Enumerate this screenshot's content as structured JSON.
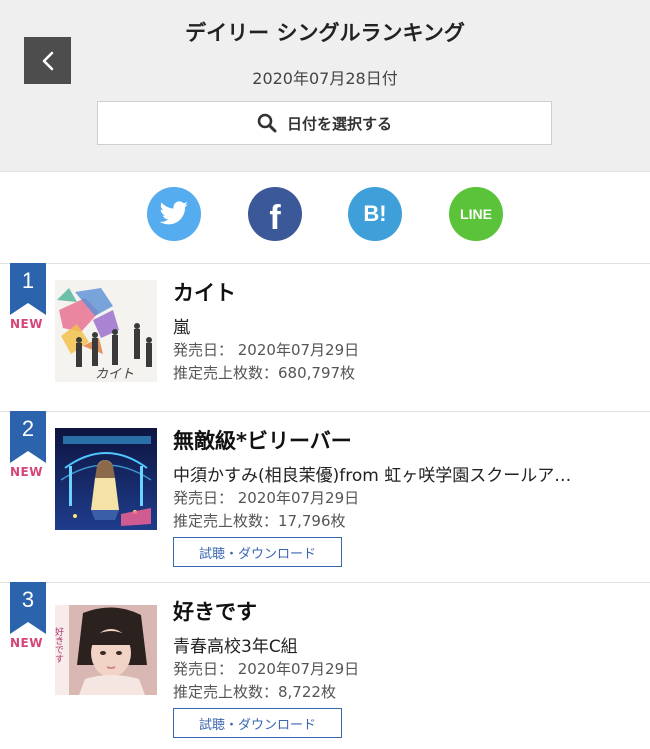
{
  "header": {
    "title": "デイリー シングルランキング",
    "date": "2020年07月28日付",
    "date_picker_label": "日付を選択する"
  },
  "share": {
    "facebook_glyph": "f",
    "hatena_glyph": "B!",
    "line_glyph": "LINE",
    "colors": {
      "twitter": "#55acee",
      "facebook": "#3b5998",
      "hatena": "#3e9fd9",
      "line": "#5ac339"
    }
  },
  "accent": {
    "rank_badge": "#2b63ad",
    "new_label": "#d6457a",
    "button": "#3b67b1"
  },
  "ranking": [
    {
      "rank": "1",
      "new": "NEW",
      "title": "カイト",
      "artist": "嵐",
      "release": "発売日： 2020年07月29日",
      "sales": "推定売上枚数：680,797枚",
      "art_text": "カイト"
    },
    {
      "rank": "2",
      "new": "NEW",
      "title": "無敵級*ビリーバー",
      "artist": "中須かすみ(相良茉優)from 虹ヶ咲学園スクールア…",
      "release": "発売日： 2020年07月29日",
      "sales": "推定売上枚数：17,796枚",
      "listen": "試聴・ダウンロード"
    },
    {
      "rank": "3",
      "new": "NEW",
      "title": "好きです",
      "artist": "青春高校3年C組",
      "release": "発売日： 2020年07月29日",
      "sales": "推定売上枚数：8,722枚",
      "listen": "試聴・ダウンロード",
      "art_text": "好きです"
    }
  ]
}
